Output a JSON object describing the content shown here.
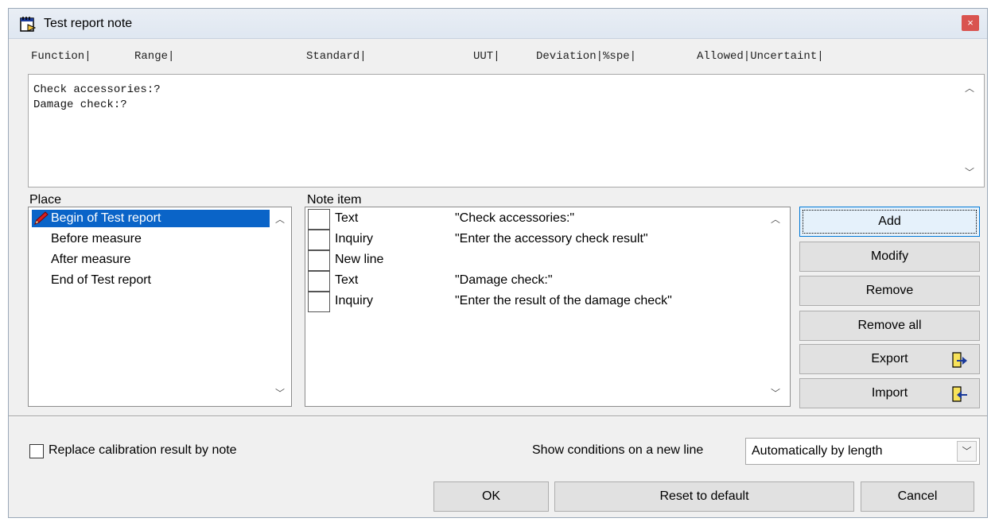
{
  "window": {
    "title": "Test report note",
    "close_label": "×"
  },
  "columns": [
    "Function|",
    "Range|",
    "Standard|",
    "UUT|",
    "Deviation|%spe|",
    "Allowed|Uncertaint|"
  ],
  "note_text": {
    "lines": [
      "Check accessories:?",
      "Damage check:?"
    ]
  },
  "place": {
    "label": "Place",
    "items": [
      "Begin of Test report",
      "Before measure",
      "After measure",
      "End of Test report"
    ],
    "selected": "Begin of Test report"
  },
  "note_item": {
    "label": "Note item",
    "rows": [
      {
        "type": "Text",
        "value": "\"Check accessories:\""
      },
      {
        "type": "Inquiry",
        "value": "\"Enter the accessory check result\""
      },
      {
        "type": "New line",
        "value": ""
      },
      {
        "type": "Text",
        "value": "\"Damage check:\""
      },
      {
        "type": "Inquiry",
        "value": "\"Enter the result of the damage check\""
      }
    ]
  },
  "buttons": {
    "add": "Add",
    "modify": "Modify",
    "remove": "Remove",
    "remove_all": "Remove all",
    "export": "Export",
    "import": "Import",
    "ok": "OK",
    "reset": "Reset to default",
    "cancel": "Cancel"
  },
  "options": {
    "replace_label": "Replace calibration result by note",
    "replace_checked": false,
    "conditions_label": "Show conditions on a new line",
    "conditions_value": "Automatically by length"
  },
  "icons": {
    "title": "note-pad-icon",
    "pencil": "pencil-icon",
    "export": "export-file-icon",
    "import": "import-file-icon"
  },
  "colors": {
    "selection": "#0a64c8",
    "close": "#d9534f",
    "icon_arrow": "#1a3a9a"
  }
}
